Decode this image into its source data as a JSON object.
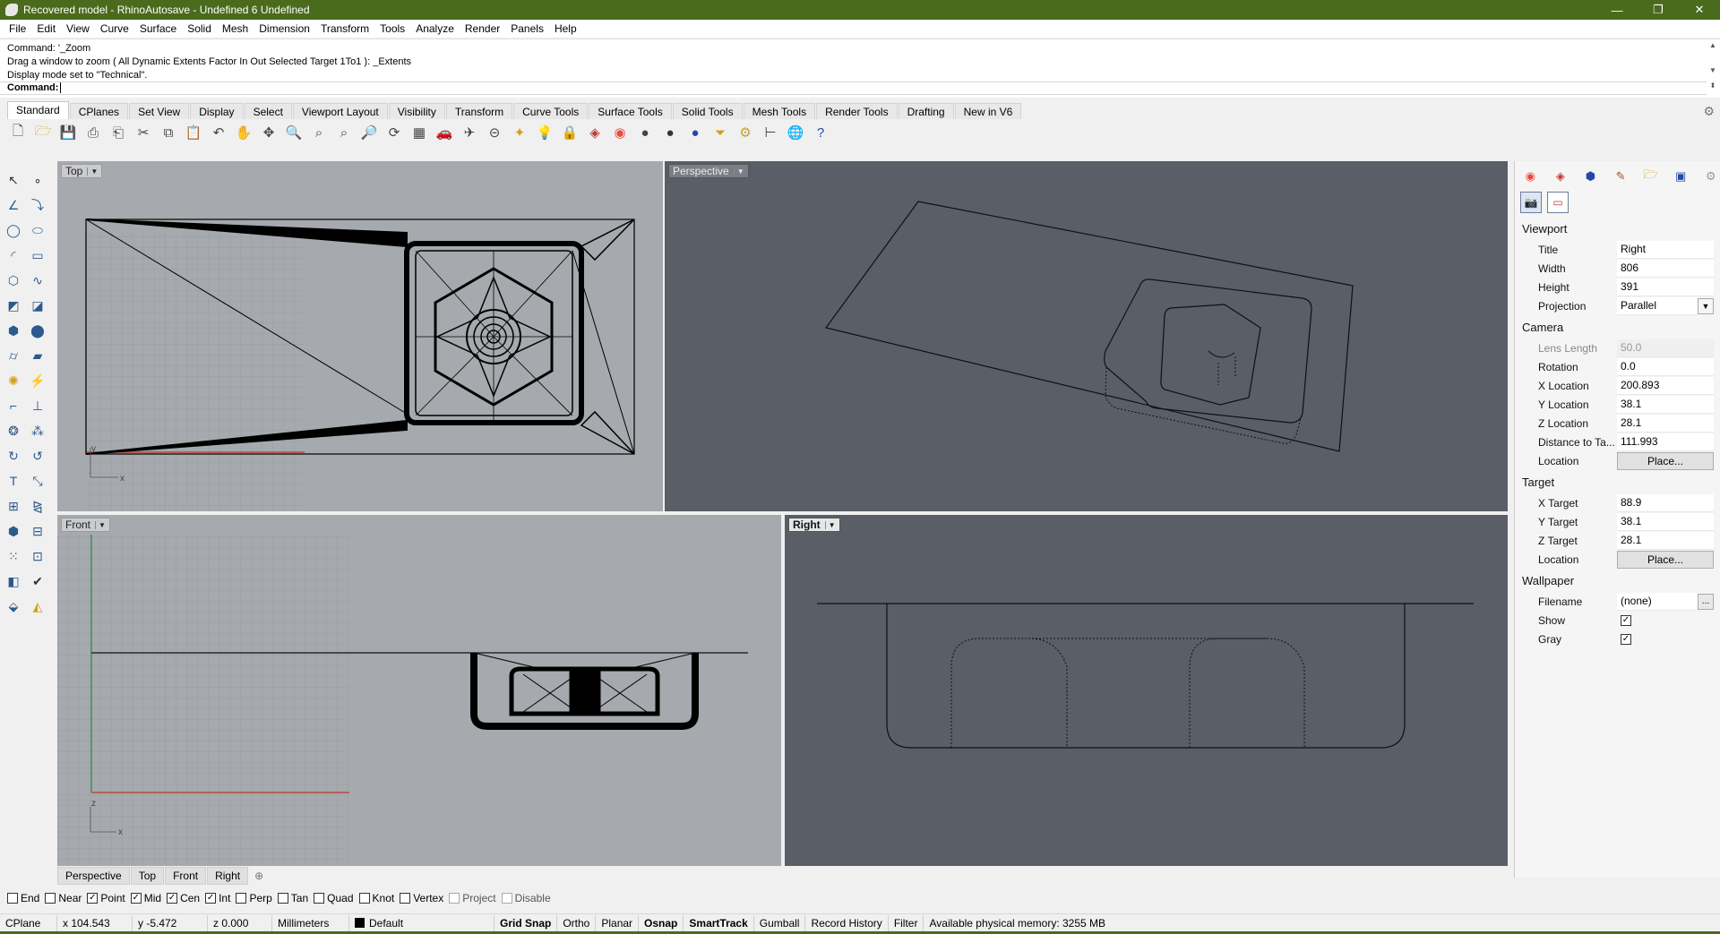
{
  "window": {
    "title": "Recovered model - RhinoAutosave - Undefined 6 Undefined",
    "controls": {
      "minimize": "—",
      "maximize": "❐",
      "close": "✕"
    }
  },
  "menu": [
    "File",
    "Edit",
    "View",
    "Curve",
    "Surface",
    "Solid",
    "Mesh",
    "Dimension",
    "Transform",
    "Tools",
    "Analyze",
    "Render",
    "Panels",
    "Help"
  ],
  "command": {
    "history": [
      "Command: '_Zoom",
      "Drag a window to zoom ( All  Dynamic  Extents  Factor  In  Out  Selected  Target  1To1 ): _Extents",
      "Display mode set to \"Technical\"."
    ],
    "prompt_label": "Command:",
    "prompt_value": ""
  },
  "toolbar_tabs": [
    "Standard",
    "CPlanes",
    "Set View",
    "Display",
    "Select",
    "Viewport Layout",
    "Visibility",
    "Transform",
    "Curve Tools",
    "Surface Tools",
    "Solid Tools",
    "Mesh Tools",
    "Render Tools",
    "Drafting",
    "New in V6"
  ],
  "toolbar_tab_active": "Standard",
  "toolbar_icons": [
    "new-icon",
    "open-icon",
    "save-icon",
    "print-icon",
    "import-icon",
    "cut-icon",
    "copy-icon",
    "paste-icon",
    "undo-icon",
    "pan-icon",
    "move-icon",
    "zoom-window-icon",
    "zoom-extents-icon",
    "zoom-selected-icon",
    "zoom-icon",
    "rotate-view-icon",
    "four-view-icon",
    "car-icon",
    "plane-icon",
    "cplane-icon",
    "point-icon",
    "light-icon",
    "lock-icon",
    "material-icon",
    "color-wheel-icon",
    "sphere-icon",
    "shaded-sphere-icon",
    "render-sphere-icon",
    "filter-icon",
    "gear-tools-icon",
    "dimension-icon",
    "globe-icon",
    "help-icon"
  ],
  "viewports": {
    "top": {
      "label": "Top"
    },
    "perspective": {
      "label": "Perspective"
    },
    "front": {
      "label": "Front"
    },
    "right": {
      "label": "Right"
    }
  },
  "viewport_tabs": [
    "Perspective",
    "Top",
    "Front",
    "Right"
  ],
  "axis_labels": {
    "x": "x",
    "y": "y",
    "z": "z"
  },
  "properties": {
    "viewport_section": "Viewport",
    "title_label": "Title",
    "title_value": "Right",
    "width_label": "Width",
    "width_value": "806",
    "height_label": "Height",
    "height_value": "391",
    "projection_label": "Projection",
    "projection_value": "Parallel",
    "camera_section": "Camera",
    "lens_label": "Lens Length",
    "lens_value": "50.0",
    "rotation_label": "Rotation",
    "rotation_value": "0.0",
    "xloc_label": "X Location",
    "xloc_value": "200.893",
    "yloc_label": "Y Location",
    "yloc_value": "38.1",
    "zloc_label": "Z Location",
    "zloc_value": "28.1",
    "dist_label": "Distance to Ta...",
    "dist_value": "111.993",
    "location_label": "Location",
    "place_button": "Place...",
    "target_section": "Target",
    "xtarget_label": "X Target",
    "xtarget_value": "88.9",
    "ytarget_label": "Y Target",
    "ytarget_value": "38.1",
    "ztarget_label": "Z Target",
    "ztarget_value": "28.1",
    "tlocation_label": "Location",
    "tplace_button": "Place...",
    "wallpaper_section": "Wallpaper",
    "filename_label": "Filename",
    "filename_value": "(none)",
    "show_label": "Show",
    "show_checked": true,
    "gray_label": "Gray",
    "gray_checked": true
  },
  "osnaps": [
    {
      "label": "End",
      "checked": false
    },
    {
      "label": "Near",
      "checked": false
    },
    {
      "label": "Point",
      "checked": true
    },
    {
      "label": "Mid",
      "checked": true
    },
    {
      "label": "Cen",
      "checked": true
    },
    {
      "label": "Int",
      "checked": true
    },
    {
      "label": "Perp",
      "checked": false
    },
    {
      "label": "Tan",
      "checked": false
    },
    {
      "label": "Quad",
      "checked": false
    },
    {
      "label": "Knot",
      "checked": false
    },
    {
      "label": "Vertex",
      "checked": false
    },
    {
      "label": "Project",
      "checked": false,
      "disabled": true
    },
    {
      "label": "Disable",
      "checked": false,
      "disabled": true
    }
  ],
  "status": {
    "cplane": "CPlane",
    "x": "x 104.543",
    "y": "y -5.472",
    "z": "z 0.000",
    "units": "Millimeters",
    "layer": "Default",
    "grid_snap": "Grid Snap",
    "ortho": "Ortho",
    "planar": "Planar",
    "osnap": "Osnap",
    "smarttrack": "SmartTrack",
    "gumball": "Gumball",
    "record_history": "Record History",
    "filter": "Filter",
    "memory": "Available physical memory: 3255 MB"
  },
  "colors": {
    "titlebar": "#4a6b1c",
    "viewport_light": "#a6a9ad",
    "viewport_dark": "#5a5e66",
    "x_axis": "#c0392b",
    "y_axis": "#2e8b3a"
  }
}
